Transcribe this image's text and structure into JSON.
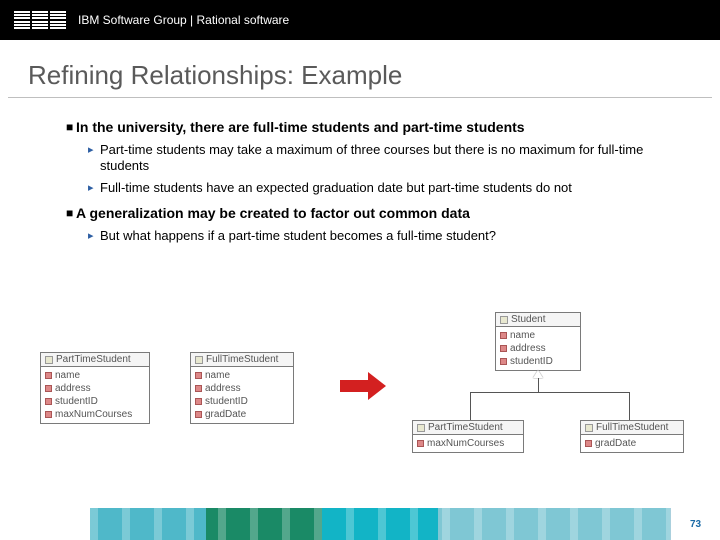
{
  "header": {
    "org": "IBM Software Group | Rational software"
  },
  "title": "Refining Relationships: Example",
  "bullets": [
    {
      "text": "In the university, there are full-time students and part-time students",
      "sub": [
        "Part-time students may take a maximum of three courses but there is no maximum for full-time students",
        "Full-time students have an expected graduation date but part-time students do not"
      ]
    },
    {
      "text": "A generalization may be created to factor out common data",
      "sub": [
        "But what happens if a part-time student becomes a full-time student?"
      ]
    }
  ],
  "uml_before": {
    "pts": {
      "name": "PartTimeStudent",
      "attrs": [
        "name",
        "address",
        "studentID",
        "maxNumCourses"
      ]
    },
    "fts": {
      "name": "FullTimeStudent",
      "attrs": [
        "name",
        "address",
        "studentID",
        "gradDate"
      ]
    }
  },
  "uml_after": {
    "parent": {
      "name": "Student",
      "attrs": [
        "name",
        "address",
        "studentID"
      ]
    },
    "pts": {
      "name": "PartTimeStudent",
      "attrs": [
        "maxNumCourses"
      ]
    },
    "fts": {
      "name": "FullTimeStudent",
      "attrs": [
        "gradDate"
      ]
    }
  },
  "slide_number": "73"
}
